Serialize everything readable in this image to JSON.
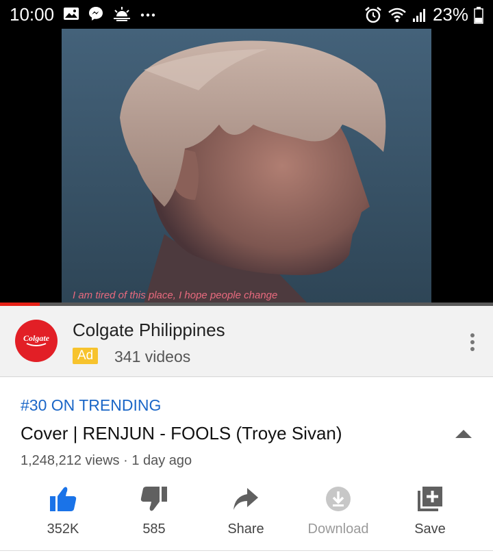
{
  "status_bar": {
    "time": "10:00",
    "battery": "23%",
    "left_icons": [
      "gallery-icon",
      "messenger-icon",
      "weather-icon",
      "more-notifications-icon"
    ],
    "right_icons": [
      "alarm-icon",
      "wifi-icon",
      "signal-icon",
      "battery-icon"
    ]
  },
  "video": {
    "subtitle": "I am tired of this place, I hope people change",
    "progress_fraction": 0.08
  },
  "ad": {
    "logo_text": "Colgate",
    "channel_name": "Colgate Philippines",
    "badge": "Ad",
    "video_count": "341 videos"
  },
  "info": {
    "trending": "#30 ON TRENDING",
    "title": "Cover | RENJUN - FOOLS (Troye Sivan)",
    "views": "1,248,212 views · 1 day ago"
  },
  "actions": {
    "like": "352K",
    "dislike": "585",
    "share": "Share",
    "download": "Download",
    "save": "Save"
  },
  "colors": {
    "accent_blue": "#1a66c7",
    "like_blue": "#1a73e8",
    "progress_red": "#e62117",
    "ad_yellow": "#f7c32d",
    "colgate_red": "#e21f26"
  }
}
